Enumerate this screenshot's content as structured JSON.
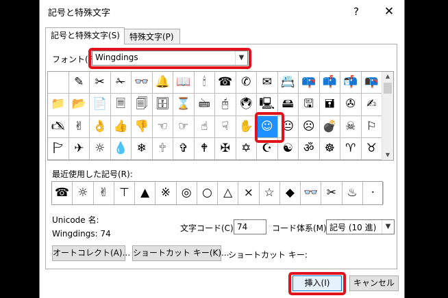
{
  "window": {
    "title": "記号と特殊文字",
    "help": "?",
    "close": "✕"
  },
  "tabs": [
    {
      "label": "記号と特殊文字(S)"
    },
    {
      "label": "特殊文字(P)"
    }
  ],
  "font": {
    "label": "フォント(F):",
    "value": "Wingdings"
  },
  "symbol_grid": {
    "rows": [
      [
        " ",
        "✎",
        "✂",
        "✁",
        "👓",
        "🔔",
        "📖",
        "🕯",
        "☎",
        "✆",
        "✉",
        "📇",
        "📪",
        "📫",
        "📬",
        "📭"
      ],
      [
        "📁",
        "📂",
        "📄",
        "🗏",
        "🗐",
        "🗄",
        "⌛",
        "🖮",
        "🖰",
        "🖲",
        "🖳",
        "🖴",
        "🖫",
        "🖬",
        "✇",
        "✍"
      ],
      [
        "🖎",
        "✌",
        "👌",
        "👍",
        "👎",
        "☜",
        "☞",
        "☝",
        "☟",
        "✋",
        "☺",
        "😐",
        "☹",
        "💣",
        "☠",
        "⚐"
      ],
      [
        "🏱",
        "✈",
        "☼",
        "💧",
        "❄",
        "🕆",
        "✞",
        "🕈",
        "✠",
        "✡",
        "☪",
        "☯",
        "ॐ",
        "☸",
        "♈",
        "♉"
      ]
    ],
    "selected": "☺"
  },
  "recent": {
    "label": "最近使用した記号(R):",
    "symbols": [
      "☎",
      "☼",
      "✌",
      "⊤",
      "▲",
      "※",
      "◎",
      "○",
      "△",
      "×",
      "☆",
      "◆",
      "👓",
      "✂",
      "♨",
      "·"
    ]
  },
  "unicode_name": {
    "label": "Unicode 名:",
    "value": "Wingdings: 74"
  },
  "char_code": {
    "label": "文字コード(C):",
    "value": "74"
  },
  "from": {
    "label": "コード体系(M):",
    "value": "記号 (10 進)"
  },
  "buttons": {
    "autocorrect": "オートコレクト(A)...",
    "shortcut": "ショートカット キー(K)...",
    "insert": "挿入(I)",
    "cancel": "キャンセル"
  },
  "shortcut_key": {
    "label": "ショートカット キー:",
    "value": ""
  },
  "highlight_color": "#e0131b",
  "selection_color": "#1e90ff"
}
